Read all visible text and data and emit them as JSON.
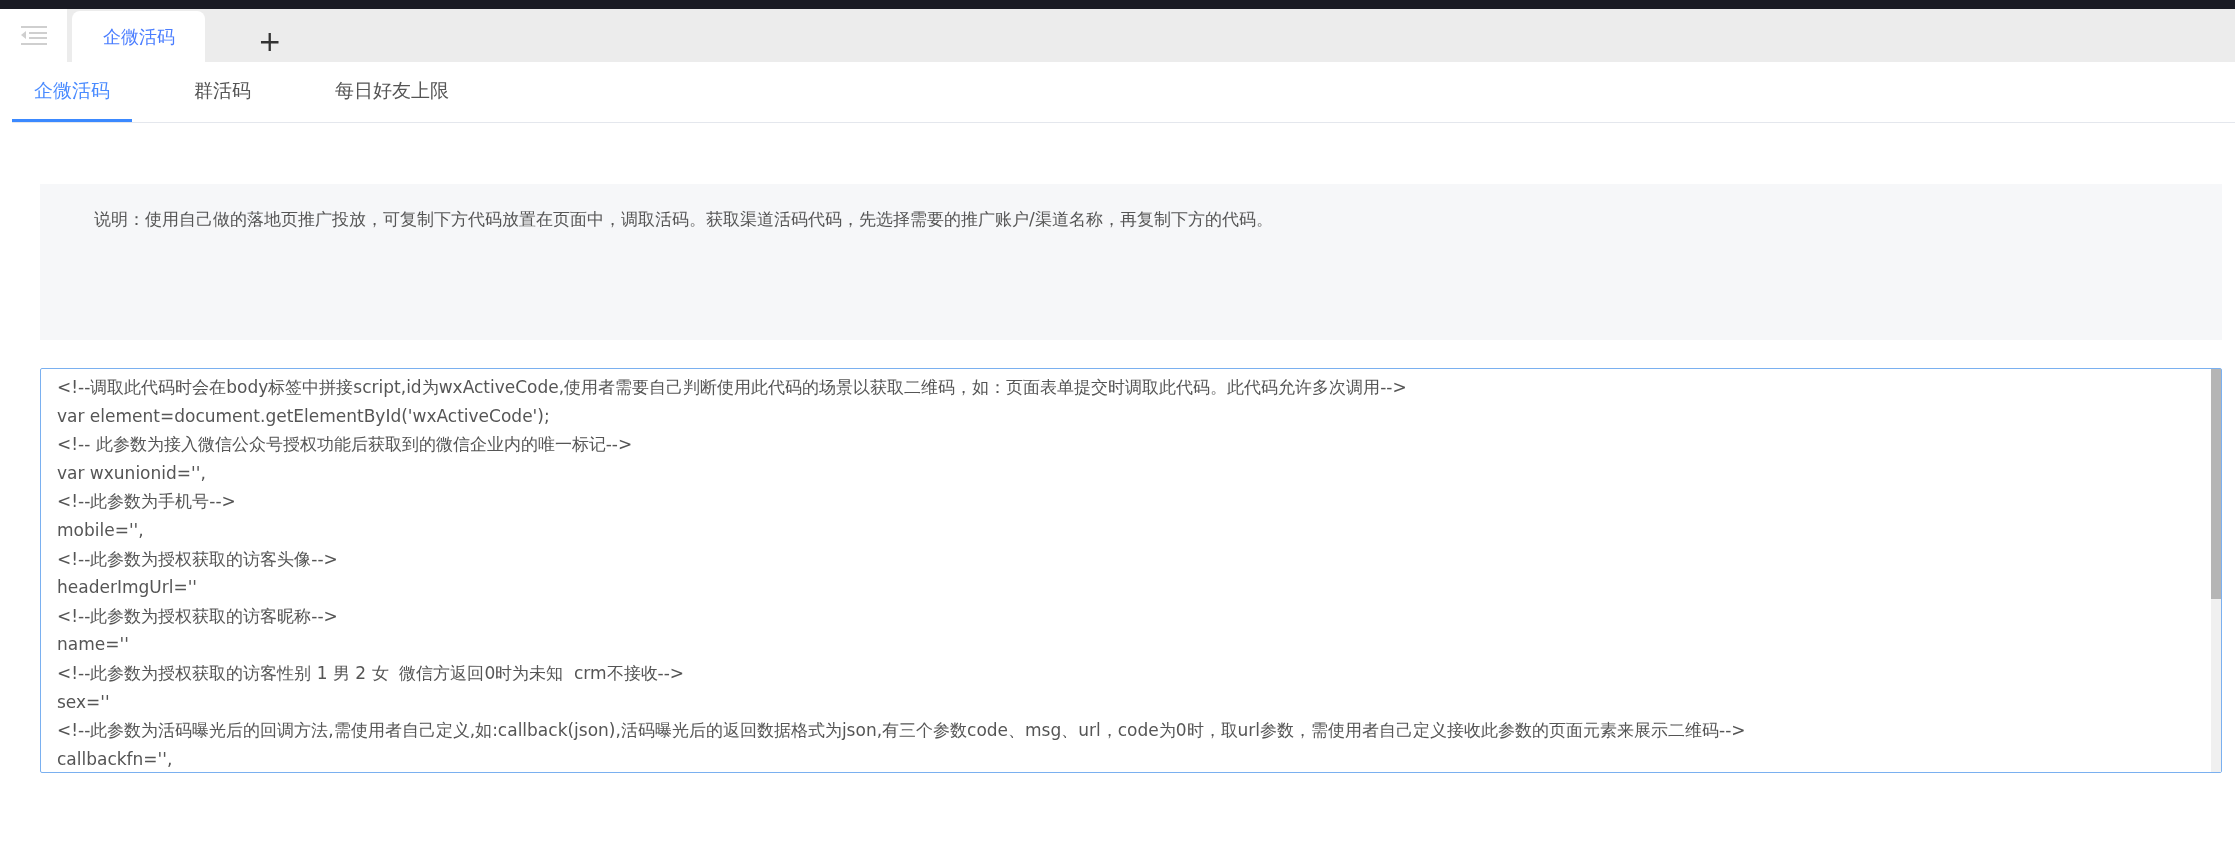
{
  "tab_bar": {
    "tabs": [
      {
        "label": "企微活码",
        "selected": true
      }
    ],
    "add_button": "+"
  },
  "sub_tabs": [
    {
      "label": "企微活码",
      "selected": true
    },
    {
      "label": "群活码",
      "selected": false
    },
    {
      "label": "每日好友上限",
      "selected": false
    }
  ],
  "description": "说明：使用自己做的落地页推广投放，可复制下方代码放置在页面中，调取活码。获取渠道活码代码，先选择需要的推广账户/渠道名称，再复制下方的代码。",
  "code_lines": [
    "<!--调取此代码时会在body标签中拼接script,id为wxActiveCode,使用者需要自己判断使用此代码的场景以获取二维码，如：页面表单提交时调取此代码。此代码允许多次调用-->",
    "var element=document.getElementById('wxActiveCode');",
    "<!-- 此参数为接入微信公众号授权功能后获取到的微信企业内的唯一标记-->",
    "var wxunionid='',",
    "<!--此参数为手机号-->",
    "mobile='',",
    "<!--此参数为授权获取的访客头像-->",
    "headerImgUrl=''",
    "<!--此参数为授权获取的访客昵称-->",
    "name=''",
    "<!--此参数为授权获取的访客性别 1 男 2 女  微信方返回0时为未知  crm不接收-->",
    "sex=''",
    "<!--此参数为活码曝光后的回调方法,需使用者自己定义,如:callback(json),活码曝光后的返回数据格式为json,有三个参数code、msg、url，code为0时，取url参数，需使用者自己定义接收此参数的页面元素来展示二维码-->",
    "callbackfn='',"
  ]
}
